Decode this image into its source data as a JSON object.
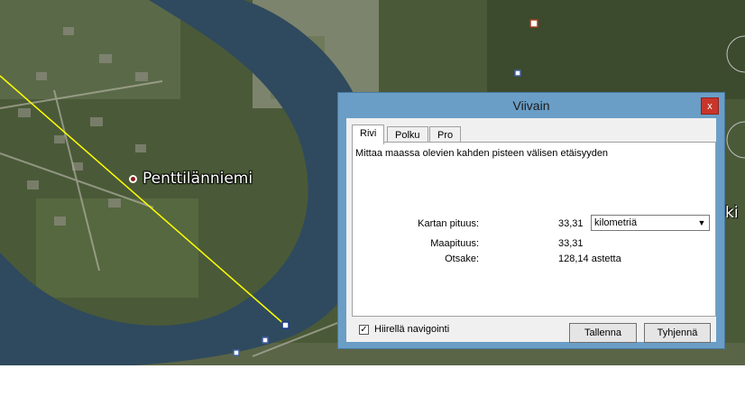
{
  "map": {
    "place_label": "Penttilänniemi",
    "edge_label": "ki"
  },
  "dialog": {
    "title": "Viivain",
    "close_glyph": "x",
    "tabs": [
      {
        "label": "Rivi",
        "active": true
      },
      {
        "label": "Polku",
        "active": false
      },
      {
        "label": "Pro",
        "active": false
      }
    ],
    "description": "Mittaa maassa olevien kahden pisteen välisen etäisyyden",
    "map_length_label": "Kartan pituus:",
    "map_length_value": "33,31",
    "unit_selected": "kilometriä",
    "ground_length_label": "Maapituus:",
    "ground_length_value": "33,31",
    "heading_label": "Otsake:",
    "heading_value": "128,14 astetta",
    "mouse_nav_label": "Hiirellä navigointi",
    "mouse_nav_checked": "✓",
    "save_label": "Tallenna",
    "clear_label": "Tyhjennä"
  },
  "colors": {
    "title_bar": "#6a9ec6",
    "close_button": "#c8362a",
    "measure_line": "#ffff00",
    "river": "#2f4a5e"
  }
}
